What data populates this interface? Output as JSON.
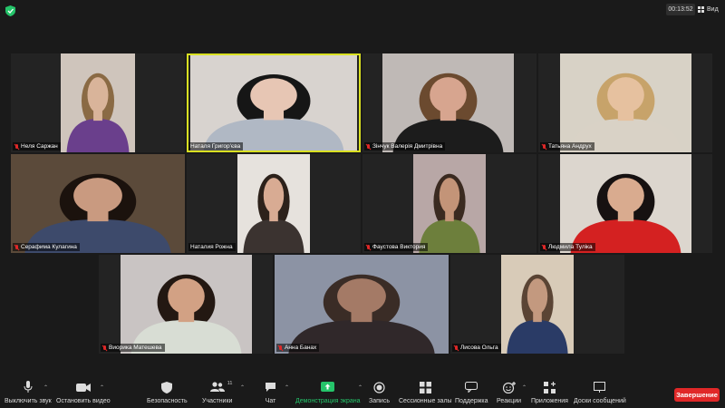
{
  "header": {
    "timer": "00:13:52",
    "view_label": "Вид"
  },
  "participants": [
    {
      "name": "Неля Саржан",
      "skin": "#d9b49a",
      "hair": "#8a6a44",
      "top": "#6a3f8c",
      "bg": "#cfc5bc"
    },
    {
      "name": "Наталя Григор'єва",
      "skin": "#e7c6b4",
      "hair": "#161616",
      "top": "#b0b8c4",
      "bg": "#d8d3cf",
      "active": true
    },
    {
      "name": "Зінчук Валерія Дмитрівна",
      "skin": "#d7a58f",
      "hair": "#6b4a2f",
      "top": "#1c1c1c",
      "bg": "#bfb9b6"
    },
    {
      "name": "Татьяна Андрух",
      "skin": "#e6c19f",
      "hair": "#c7a36a",
      "top": "#d9d2c6",
      "bg": "#d8d2c6"
    },
    {
      "name": "Серафима Кулагина",
      "skin": "#c99a80",
      "hair": "#1b120d",
      "top": "#3d4a6b",
      "bg": "#5b4a3a"
    },
    {
      "name": "Наталия Рожна",
      "skin": "#d8ab93",
      "hair": "#2c211a",
      "top": "#3b3330",
      "bg": "#e6e2dd"
    },
    {
      "name": "Фаустова Виктория",
      "skin": "#c39478",
      "hair": "#3a2a20",
      "top": "#6d7f3c",
      "bg": "#b8a7a6"
    },
    {
      "name": "Людмила Тулiка",
      "skin": "#d9ab8f",
      "hair": "#161111",
      "top": "#d42121",
      "bg": "#dcd6ce"
    },
    {
      "name": "Виорика Матешева",
      "skin": "#d2a184",
      "hair": "#231812",
      "top": "#d8ddd4",
      "bg": "#c9c4c3"
    },
    {
      "name": "Анна Банах",
      "skin": "#a47a66",
      "hair": "#3a2c26",
      "top": "#30282a",
      "bg": "#8c93a4"
    },
    {
      "name": "Лисова Ольга",
      "skin": "#c3997f",
      "hair": "#5a4434",
      "top": "#2a3b66",
      "bg": "#d8cbb8"
    }
  ],
  "toolbar": {
    "mute": "Выключить звук",
    "video": "Остановить видео",
    "security": "Безопасность",
    "participants": "Участники",
    "participants_count": "11",
    "chat": "Чат",
    "share": "Демонстрация экрана",
    "record": "Запись",
    "breakout": "Сессионные залы",
    "support": "Поддержка",
    "reactions": "Реакции",
    "apps": "Приложения",
    "whiteboards": "Доски сообщений",
    "end": "Завершение"
  },
  "colors": {
    "accent_green": "#25c46a",
    "end_red": "#e02828",
    "active_speaker": "#d9e021"
  }
}
